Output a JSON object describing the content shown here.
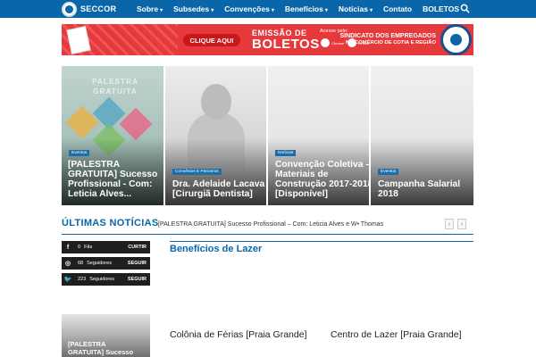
{
  "header": {
    "logo_text": "SECCOR",
    "menu": [
      {
        "label": "Sobre",
        "caret": "▾"
      },
      {
        "label": "Subsedes",
        "caret": "▾"
      },
      {
        "label": "Convenções",
        "caret": "▾"
      },
      {
        "label": "Benefícios",
        "caret": "▾"
      },
      {
        "label": "Notícias",
        "caret": "▾"
      },
      {
        "label": "Contato",
        "caret": ""
      },
      {
        "label": "BOLETOS",
        "caret": ""
      }
    ],
    "search_icon": "search-icon"
  },
  "banner": {
    "cta": "CLIQUE AQUI",
    "line1": "EMISSÃO DE",
    "line2": "BOLETOS",
    "access_via": "Acesse pelo:",
    "app1": "Chrome",
    "app2": "Firefox",
    "org_line1": "SINDICATO DOS EMPREGADOS",
    "org_line2": "NO COMÉRCIO DE COTIA E REGIÃO"
  },
  "slider": [
    {
      "tag": "Eventos",
      "title_lines": [
        "[PALESTRA",
        "GRATUITA] Sucesso",
        "Profissional - Com:",
        "Leticia Alves..."
      ],
      "bg_text": "PALESTRA GRATUITA"
    },
    {
      "tag": "Convênios E Parceiros",
      "title_lines": [
        "Dra. Adelaide Lacava",
        "[Cirurgiã Dentista]"
      ]
    },
    {
      "tag": "Notícias",
      "title_lines": [
        "Convenção Coletiva –",
        "Materiais de",
        "Construção 2017-2018",
        "[Disponível]"
      ]
    },
    {
      "tag": "Eventos",
      "title_lines": [
        "Campanha Salarial",
        "2018"
      ]
    }
  ],
  "ticker": {
    "heading": "ÚLTIMAS NOTÍCIAS",
    "text": "[PALESTRA GRATUITA] Sucesso Profissional – Com: Leticia Alves e W• Thomas",
    "prev": "‹",
    "next": "›"
  },
  "social": [
    {
      "icon": "facebook-icon",
      "glyph": "f",
      "count": "0",
      "unit": "Fãs",
      "action": "CURTIR"
    },
    {
      "icon": "instagram-icon",
      "glyph": "◎",
      "count": "68",
      "unit": "Seguidores",
      "action": "SEGUIR"
    },
    {
      "icon": "twitter-icon",
      "glyph": "🐦",
      "count": "223",
      "unit": "Seguidores",
      "action": "SEGUIR"
    }
  ],
  "sidebar_card": {
    "title_lines": [
      "[PALESTRA",
      "GRATUITA] Sucesso"
    ]
  },
  "section": {
    "title": "Benefícios de Lazer",
    "items": [
      {
        "title": "Colônia de Férias [Praia Grande]"
      },
      {
        "title": "Centro de Lazer [Praia Grande]"
      }
    ]
  },
  "colors": {
    "brand": "#0a66a8",
    "banner_red": "#e6393c",
    "tag_blue": "#1d6ea8"
  }
}
